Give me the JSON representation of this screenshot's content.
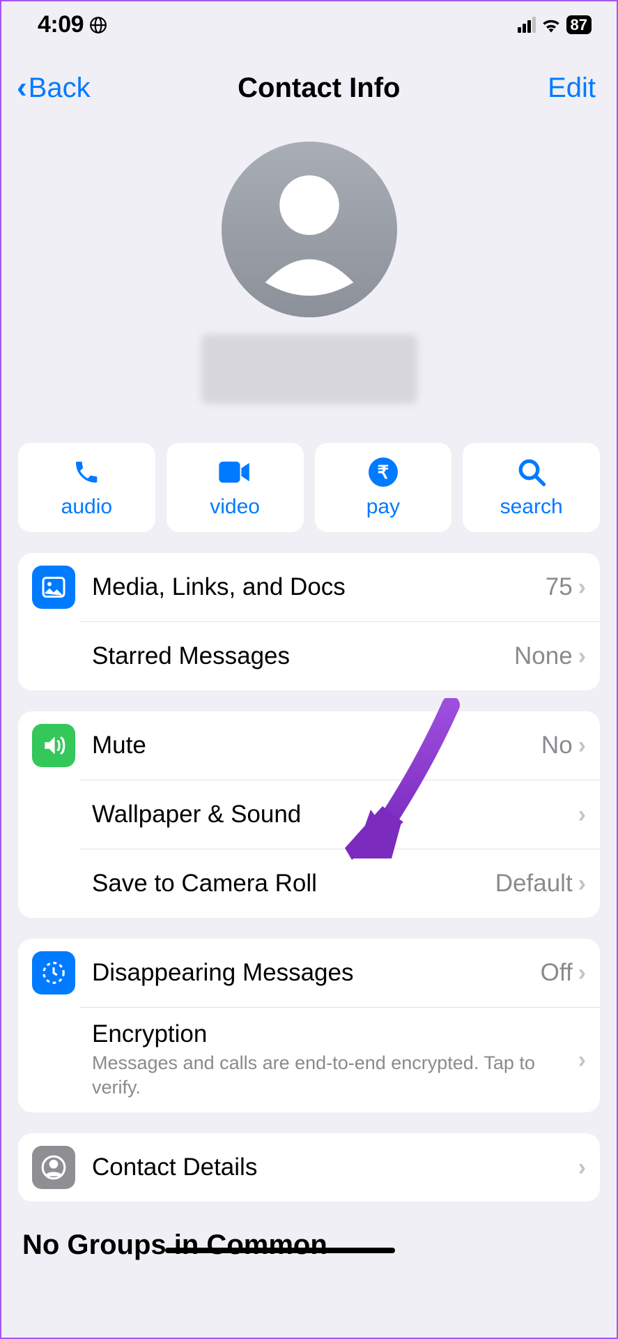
{
  "status": {
    "time": "4:09",
    "battery": "87"
  },
  "nav": {
    "back": "Back",
    "title": "Contact Info",
    "edit": "Edit"
  },
  "actions": {
    "audio": "audio",
    "video": "video",
    "pay": "pay",
    "pay_symbol": "₹",
    "search": "search"
  },
  "rows": {
    "media": {
      "label": "Media, Links, and Docs",
      "value": "75"
    },
    "starred": {
      "label": "Starred Messages",
      "value": "None"
    },
    "mute": {
      "label": "Mute",
      "value": "No"
    },
    "wallpaper": {
      "label": "Wallpaper & Sound"
    },
    "save_roll": {
      "label": "Save to Camera Roll",
      "value": "Default"
    },
    "disappearing": {
      "label": "Disappearing Messages",
      "value": "Off"
    },
    "encryption": {
      "label": "Encryption",
      "sub": "Messages and calls are end-to-end encrypted. Tap to verify."
    },
    "contact_details": {
      "label": "Contact Details"
    }
  },
  "section_groups": "No Groups in Common"
}
